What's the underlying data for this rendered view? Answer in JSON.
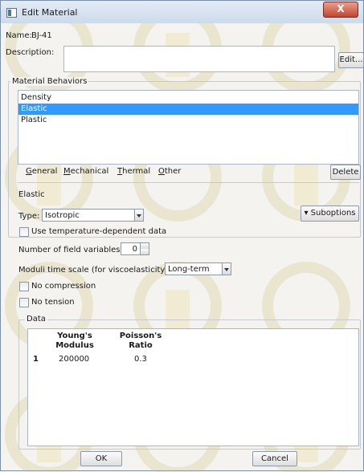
{
  "window": {
    "title": "Edit Material",
    "close_glyph": "X"
  },
  "material": {
    "name_label": "Name:",
    "name_value": "BJ-41",
    "description_label": "Description:",
    "description_value": "",
    "edit_button": "Edit..."
  },
  "behaviors": {
    "group_label": "Material Behaviors",
    "items": [
      {
        "label": "Density",
        "selected": false
      },
      {
        "label": "Elastic",
        "selected": true
      },
      {
        "label": "Plastic",
        "selected": false
      }
    ]
  },
  "menu": {
    "items": [
      {
        "key": "G",
        "rest": "eneral"
      },
      {
        "key": "M",
        "rest": "echanical"
      },
      {
        "key": "T",
        "rest": "hermal"
      },
      {
        "key": "O",
        "rest": "ther"
      }
    ],
    "delete_button": "Delete"
  },
  "elastic": {
    "section_label": "Elastic",
    "type_label": "Type:",
    "type_value": "Isotropic",
    "suboptions_button": "Suboptions",
    "use_temp_label": "Use temperature-dependent data",
    "field_vars_label": "Number of field variables:",
    "field_vars_value": "0",
    "moduli_label": "Moduli time scale (for viscoelasticity):",
    "moduli_value": "Long-term",
    "no_compression_label": "No compression",
    "no_tension_label": "No tension"
  },
  "data_table": {
    "group_label": "Data",
    "headers": [
      {
        "line1": "Young's",
        "line2": "Modulus"
      },
      {
        "line1": "Poisson's",
        "line2": "Ratio"
      }
    ],
    "rows": [
      {
        "index": "1",
        "youngs_modulus": "200000",
        "poissons_ratio": "0.3"
      }
    ]
  },
  "footer": {
    "ok_button": "OK",
    "cancel_button": "Cancel"
  },
  "colors": {
    "selection": "#3399ff",
    "watermark": "#e2d59a",
    "window_bg": "#f4f3ef"
  }
}
